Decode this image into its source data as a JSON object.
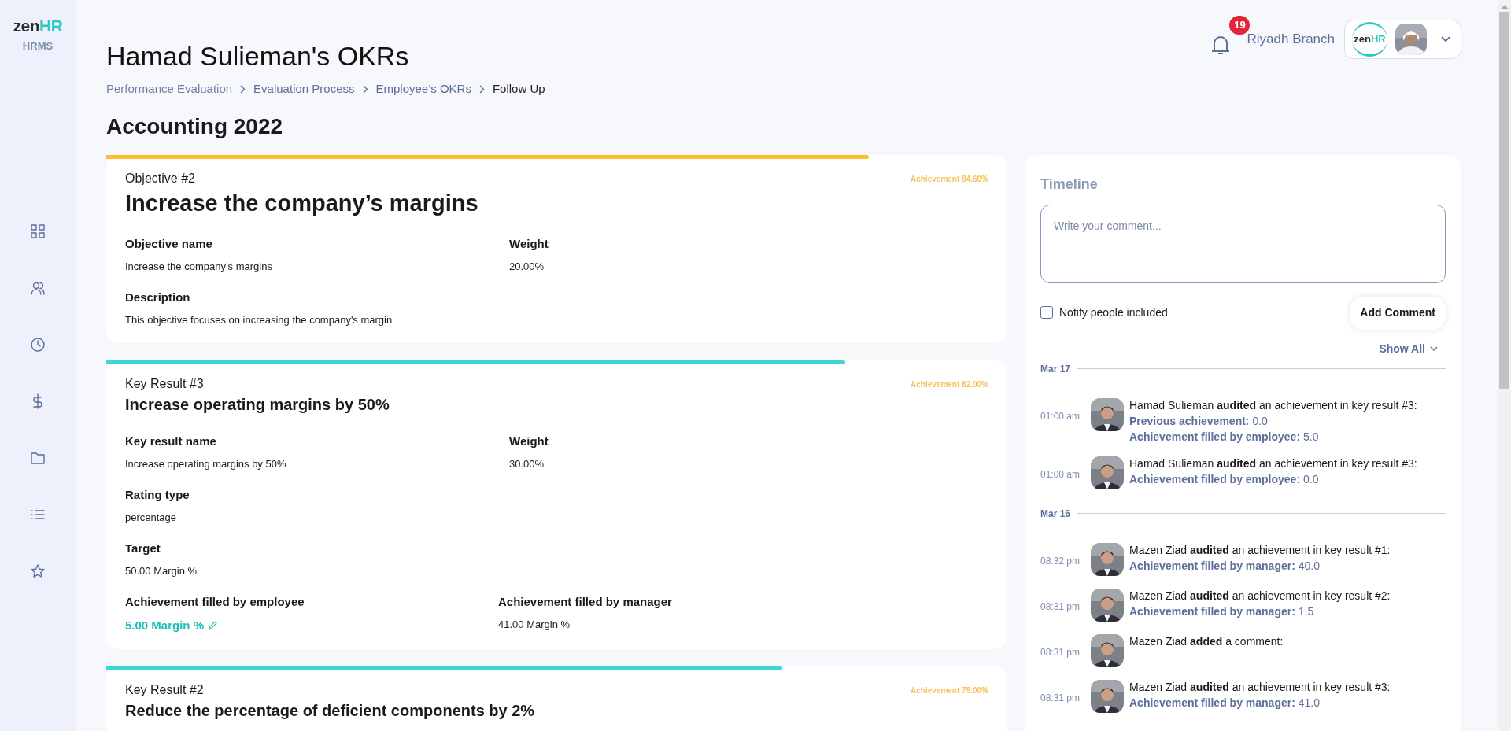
{
  "sidebar": {
    "logo": {
      "brand": "zen",
      "brand_accent": "HR",
      "subtitle": "HRMS"
    }
  },
  "header": {
    "notification_count": "19",
    "branch": "Riyadh Branch",
    "account_logo": {
      "brand": "zen",
      "brand_accent": "HR"
    }
  },
  "page_title": "Hamad Sulieman's OKRs",
  "breadcrumb": [
    {
      "label": "Performance Evaluation",
      "link": false
    },
    {
      "label": "Evaluation Process",
      "link": true
    },
    {
      "label": "Employee’s OKRs",
      "link": true
    },
    {
      "label": "Follow Up",
      "link": false,
      "current": true
    }
  ],
  "section_title": "Accounting 2022",
  "cards": [
    {
      "kind": "objective",
      "eyebrow": "Objective #2",
      "title": "Increase the company’s margins",
      "achievement": "Achievement 84.60%",
      "level": 0.846,
      "rows": [
        [
          {
            "label": "Objective name",
            "value": "Increase the company’s margins",
            "kind": "text"
          },
          {
            "label": "Weight",
            "value": "20.00%",
            "kind": "text"
          }
        ],
        [
          {
            "label": "Description",
            "value": "This objective focuses on increasing the company's margin",
            "kind": "text"
          }
        ]
      ]
    },
    {
      "kind": "key_result",
      "eyebrow": "Key Result #3",
      "title": "Increase operating margins by 50%",
      "achievement": "Achievement 82.00%",
      "level": 0.82,
      "rows": [
        [
          {
            "label": "Key result name",
            "value": "Increase operating margins by 50%",
            "kind": "text"
          },
          {
            "label": "Weight",
            "value": "30.00%",
            "kind": "text"
          }
        ],
        [
          {
            "label": "Rating type",
            "value": "percentage",
            "kind": "text"
          }
        ],
        [
          {
            "label": "Target",
            "value": "50.00 Margin %",
            "kind": "text"
          }
        ],
        [
          {
            "label": "Achievement filled by employee",
            "value": "5.00 Margin %",
            "kind": "editable"
          },
          {
            "label": "Achievement filled by manager",
            "value": "41.00 Margin %",
            "kind": "text"
          }
        ]
      ]
    },
    {
      "kind": "key_result",
      "eyebrow": "Key Result #2",
      "title": "Reduce the percentage of deficient components by 2%",
      "achievement": "Achievement 75.00%",
      "level": 0.75
    }
  ],
  "timeline": {
    "title": "Timeline",
    "comment": {
      "placeholder": "Write your comment..."
    },
    "notify": {
      "label": "Notify people included",
      "checked": false
    },
    "add_button": "Add Comment",
    "show_all": "Show All",
    "groups": [
      {
        "date": "Mar 17",
        "entries": [
          {
            "time": "01:00 am",
            "message": "Hamad Sulieman **audited** an achievement in key result #3:",
            "details": [
              {
                "label": "Previous achievement:",
                "value": "0.0"
              },
              {
                "label": "Achievement filled by employee:",
                "value": "5.0"
              }
            ]
          },
          {
            "time": "01:00 am",
            "message": "Hamad Sulieman **audited** an achievement in key result #3:",
            "details": [
              {
                "label": "Achievement filled by employee:",
                "value": "0.0"
              }
            ]
          }
        ]
      },
      {
        "date": "Mar 16",
        "entries": [
          {
            "time": "08:32 pm",
            "message": "Mazen Ziad **audited** an achievement in key result #1:",
            "details": [
              {
                "label": "Achievement filled by manager:",
                "value": "40.0"
              }
            ]
          },
          {
            "time": "08:31 pm",
            "message": "Mazen Ziad **audited** an achievement in key result #2:",
            "details": [
              {
                "label": "Achievement filled by manager:",
                "value": "1.5"
              }
            ]
          },
          {
            "time": "08:31 pm",
            "message": "Mazen Ziad **added** a comment:"
          },
          {
            "time": "08:31 pm",
            "message": "Mazen Ziad **audited** an achievement in key result #3:",
            "details": [
              {
                "label": "Achievement filled by manager:",
                "value": "41.0"
              }
            ]
          }
        ]
      }
    ]
  }
}
